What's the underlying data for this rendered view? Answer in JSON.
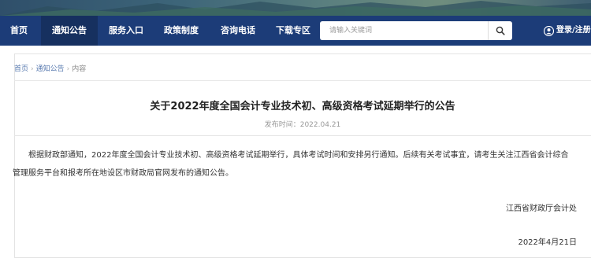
{
  "nav": {
    "items": [
      {
        "label": "首页",
        "active": false
      },
      {
        "label": "通知公告",
        "active": true
      },
      {
        "label": "服务入口",
        "active": false
      },
      {
        "label": "政策制度",
        "active": false
      },
      {
        "label": "咨询电话",
        "active": false
      },
      {
        "label": "下载专区",
        "active": false
      }
    ],
    "search_placeholder": "请输入关键词",
    "login_label": "登录/注册"
  },
  "breadcrumb": {
    "home": "首页",
    "section": "通知公告",
    "current": "内容",
    "separator": "›"
  },
  "article": {
    "title": "关于2022年度全国会计专业技术初、高级资格考试延期举行的公告",
    "pub_label": "发布时间：",
    "pub_date": "2022.04.21",
    "body_line1": "根据财政部通知，2022年度全国会计专业技术初、高级资格考试延期举行，具体考试时间和安排另行通知。后续有关考试事宜，请考生关注江西省会计综合",
    "body_line2": "管理服务平台和报考所在地设区市财政局官网发布的通知公告。",
    "signature_org": "江西省财政厅会计处",
    "signature_date": "2022年4月21日"
  },
  "colors": {
    "nav_bg": "#1c3c78",
    "nav_active_bg": "#16305f",
    "link": "#5a7bb0"
  },
  "icons": [
    "search-icon",
    "user-icon"
  ]
}
